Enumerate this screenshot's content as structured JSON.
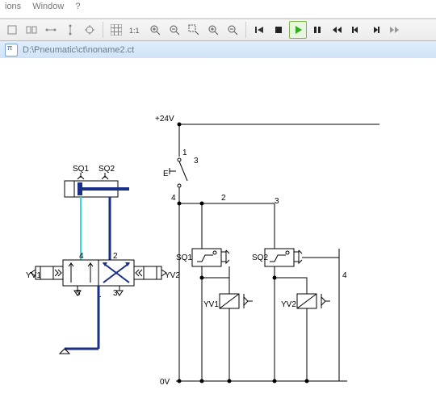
{
  "menu": {
    "items": [
      "ions",
      "Window",
      "?"
    ]
  },
  "document": {
    "path": "D:\\Pneumatic\\ct\\noname2.ct"
  },
  "toolbar": {
    "icons": [
      "rect",
      "rect-stack",
      "spacer-h",
      "spacer-v",
      "crosshair",
      "sep",
      "grid",
      "one-to-one",
      "zoom-fit-plus",
      "zoom-fit-minus",
      "zoom-region",
      "zoom-in",
      "zoom-out",
      "sep",
      "rewind",
      "stop",
      "play",
      "pause",
      "prev",
      "step-back",
      "step-fwd",
      "next"
    ]
  },
  "schematic": {
    "supply": "+24V",
    "ground": "0V",
    "cylinder": {
      "sensors": [
        "SQ1",
        "SQ2"
      ]
    },
    "valve": {
      "ports": [
        "1",
        "2",
        "3",
        "4",
        "5"
      ],
      "solenoids": [
        "YV1",
        "YV2"
      ]
    },
    "ladder": {
      "switch": {
        "nodes": [
          "1",
          "3",
          "4",
          "2"
        ],
        "label": "E"
      },
      "relays": [
        "SQ1",
        "SQ2"
      ],
      "node3": "3",
      "node4": "4",
      "coils": [
        "YV1",
        "YV2"
      ]
    }
  }
}
